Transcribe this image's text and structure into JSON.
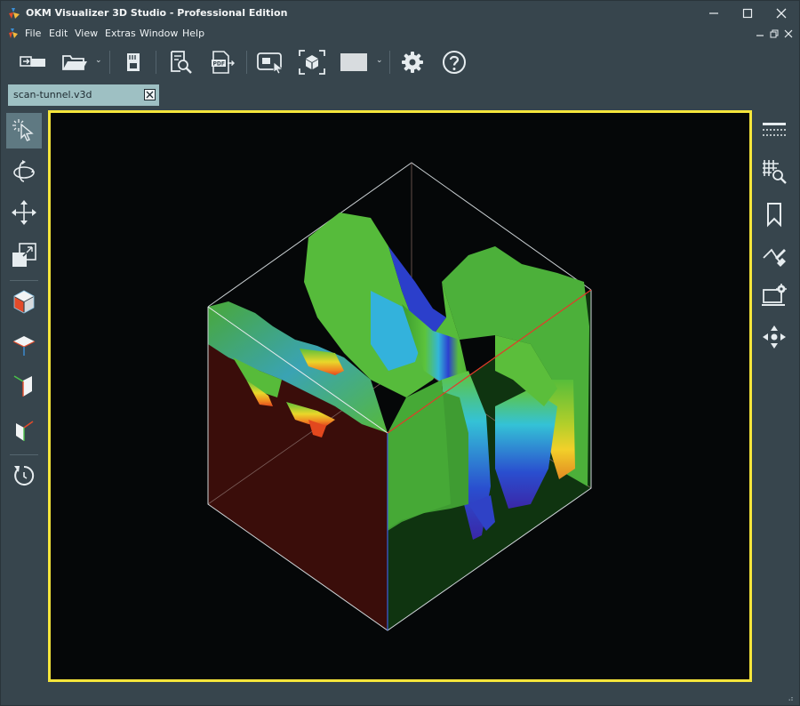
{
  "window": {
    "title": "OKM Visualizer 3D Studio - Professional Edition",
    "controls": [
      "minimize",
      "maximize",
      "close"
    ]
  },
  "menu": {
    "items": [
      {
        "label": "File"
      },
      {
        "label": "Edit"
      },
      {
        "label": "View"
      },
      {
        "label": "Extras"
      },
      {
        "label": "Window"
      },
      {
        "label": "Help"
      }
    ]
  },
  "toolbar": {
    "buttons": [
      {
        "icon": "import-device-icon"
      },
      {
        "icon": "open-folder-icon",
        "dropdown": true
      },
      {
        "icon": "save-card-icon"
      },
      {
        "icon": "print-preview-icon"
      },
      {
        "icon": "export-pdf-icon"
      },
      {
        "icon": "screenshot-icon"
      },
      {
        "icon": "fit-view-icon"
      },
      {
        "icon": "background-color-icon",
        "dropdown": true
      },
      {
        "icon": "settings-icon"
      },
      {
        "icon": "help-icon"
      }
    ]
  },
  "document_tab": {
    "label": "scan-tunnel.v3d"
  },
  "left_tools": [
    {
      "icon": "select-icon",
      "active": true
    },
    {
      "icon": "rotate-icon"
    },
    {
      "icon": "pan-icon"
    },
    {
      "icon": "zoom-icon"
    },
    {
      "icon": "view-3d-icon"
    },
    {
      "icon": "view-top-icon"
    },
    {
      "icon": "view-front-icon"
    },
    {
      "icon": "view-side-icon"
    },
    {
      "icon": "reset-view-icon"
    }
  ],
  "right_tools": [
    {
      "icon": "surface-settings-icon"
    },
    {
      "icon": "grid-zoom-icon"
    },
    {
      "icon": "bookmark-icon"
    },
    {
      "icon": "measure-icon"
    },
    {
      "icon": "display-settings-icon"
    },
    {
      "icon": "navigate-icon"
    }
  ],
  "colors": {
    "background": "#37454d",
    "viewport_border": "#f5e53b",
    "viewport_bg": "#050708",
    "tab": "#9ec0c3",
    "active_tool": "#5f7982"
  }
}
